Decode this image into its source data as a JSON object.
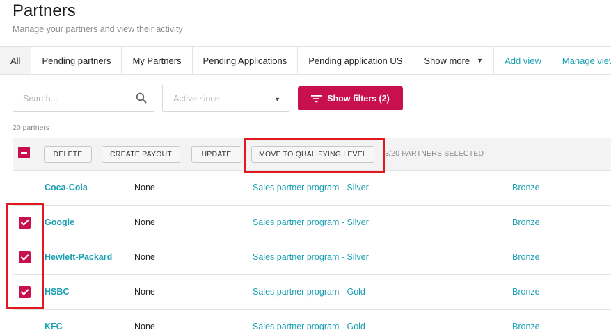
{
  "page": {
    "title": "Partners",
    "subtitle": "Manage your partners and view their activity"
  },
  "tabs": {
    "items": [
      {
        "label": "All"
      },
      {
        "label": "Pending partners"
      },
      {
        "label": "My Partners"
      },
      {
        "label": "Pending Applications"
      },
      {
        "label": "Pending application US"
      },
      {
        "label": "Show more"
      }
    ],
    "add_view": "Add view",
    "manage_views": "Manage views"
  },
  "filters": {
    "search_placeholder": "Search...",
    "active_since_placeholder": "Active since",
    "show_filters_label": "Show filters (2)"
  },
  "count_text": "20 partners",
  "bulk_actions": {
    "delete": "DELETE",
    "create_payout": "CREATE PAYOUT",
    "update": "UPDATE",
    "move_to_qualifying": "MOVE TO QUALIFYING LEVEL",
    "selected_text": "3/20 PARTNERS SELECTED"
  },
  "rows": [
    {
      "name": "Coca-Cola",
      "status": "None",
      "program": "Sales partner program - Silver",
      "level": "Bronze",
      "checked": false
    },
    {
      "name": "Google",
      "status": "None",
      "program": "Sales partner program - Silver",
      "level": "Bronze",
      "checked": true
    },
    {
      "name": "Hewlett-Packard",
      "status": "None",
      "program": "Sales partner program - Silver",
      "level": "Bronze",
      "checked": true
    },
    {
      "name": "HSBC",
      "status": "None",
      "program": "Sales partner program - Gold",
      "level": "Bronze",
      "checked": true
    },
    {
      "name": "KFC",
      "status": "None",
      "program": "Sales partner program - Gold",
      "level": "Bronze",
      "checked": false
    }
  ],
  "colors": {
    "accent": "#c8104f",
    "link": "#1aa0b3",
    "highlight": "#e0191f"
  }
}
